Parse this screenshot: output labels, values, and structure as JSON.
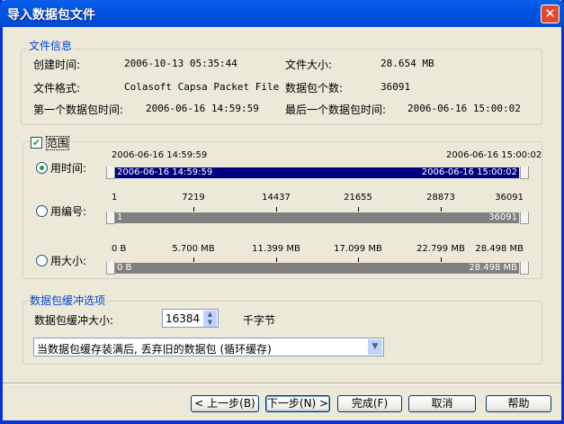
{
  "window": {
    "title": "导入数据包文件",
    "close_icon": "close-icon"
  },
  "file_info": {
    "legend": "文件信息",
    "created_label": "创建时间:",
    "created_value": "2006-10-13 05:35:44",
    "size_label": "文件大小:",
    "size_value": "28.654 MB",
    "format_label": "文件格式:",
    "format_value": "Colasoft Capsa Packet File",
    "count_label": "数据包个数:",
    "count_value": "36091",
    "first_label": "第一个数据包时间:",
    "first_value": "2006-06-16 14:59:59",
    "last_label": "最后一个数据包时间:",
    "last_value": "2006-06-16 15:00:02"
  },
  "range": {
    "label": "范围",
    "checked": true,
    "by_time": {
      "label": "用时间:",
      "selected": true,
      "min": "2006-06-16 14:59:59",
      "max": "2006-06-16 15:00:02",
      "from": "2006-06-16 14:59:59",
      "to": "2006-06-16 15:00:02"
    },
    "by_number": {
      "label": "用编号:",
      "selected": false,
      "ticks": [
        "1",
        "7219",
        "14437",
        "21655",
        "28873",
        "36091"
      ],
      "from": "1",
      "to": "36091"
    },
    "by_size": {
      "label": "用大小:",
      "selected": false,
      "ticks": [
        "0  B",
        "5.700 MB",
        "11.399 MB",
        "17.099 MB",
        "22.799 MB",
        "28.498 MB"
      ],
      "from": "0  B",
      "to": "28.498 MB"
    }
  },
  "buffer": {
    "legend": "数据包缓冲选项",
    "size_label": "数据包缓冲大小:",
    "size_value": "16384",
    "unit": "千字节",
    "mode": "当数据包缓存装满后, 丢弃旧的数据包 (循环缓存)"
  },
  "buttons": {
    "back": "< 上一步(B)",
    "next": "下一步(N) >",
    "finish": "完成(F)",
    "cancel": "取消",
    "help": "帮助"
  },
  "colors": {
    "title_bar": "#0054e3",
    "selected_range": "#000080",
    "inactive_range": "#808080"
  }
}
